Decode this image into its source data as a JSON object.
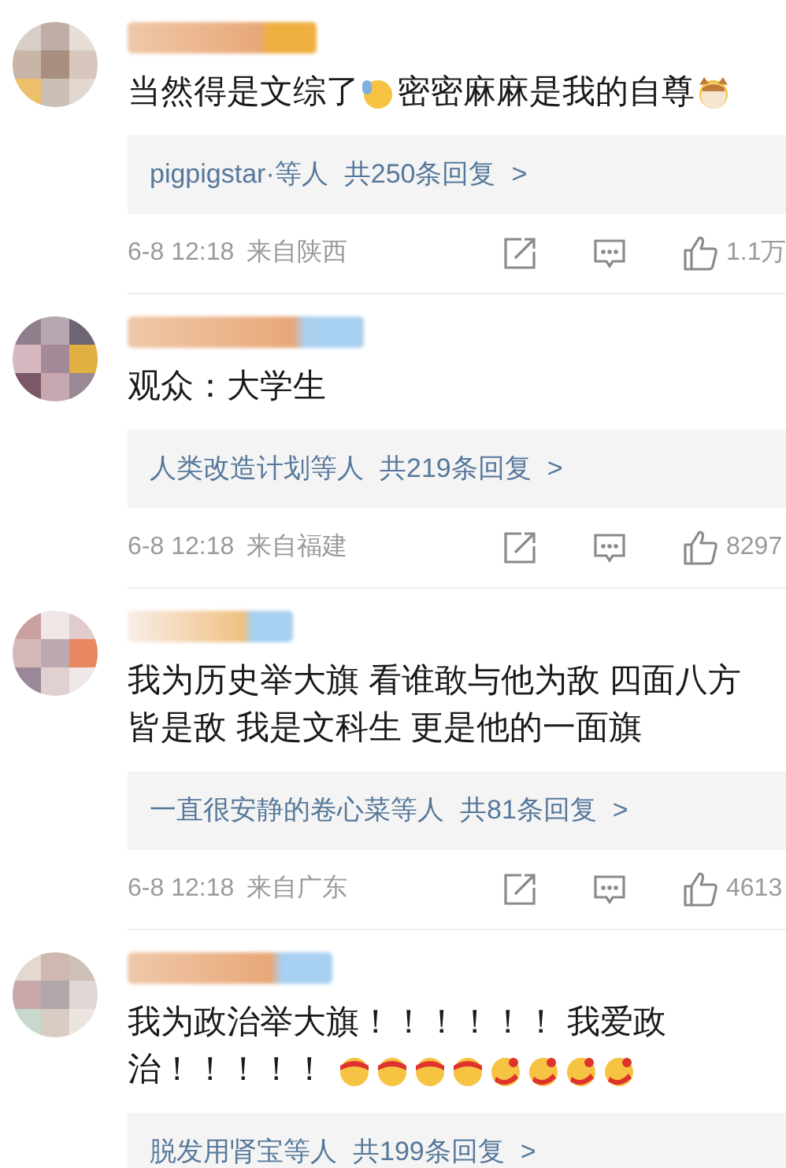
{
  "comments": [
    {
      "lines": [
        [
          {
            "kind": "text",
            "text": "当然得是文综了"
          },
          {
            "kind": "waving"
          },
          {
            "kind": "text",
            "text": "密密麻麻是我的自尊"
          },
          {
            "kind": "cat"
          }
        ]
      ],
      "reply": {
        "names": "pigpigstar·等人",
        "count": "共250条回复",
        "chevron": ">"
      },
      "time": "6-8 12:18",
      "location": "来自陕西",
      "likes": "1.1万"
    },
    {
      "lines": [
        [
          {
            "kind": "text",
            "text": "观众：大学生"
          }
        ]
      ],
      "reply": {
        "names": "人类改造计划等人",
        "count": "共219条回复",
        "chevron": ">"
      },
      "time": "6-8 12:18",
      "location": "来自福建",
      "likes": "8297"
    },
    {
      "lines": [
        [
          {
            "kind": "text",
            "text": "我为历史举大旗 看谁敢与他为敌 四面八方"
          }
        ],
        [
          {
            "kind": "text",
            "text": "皆是敌 我是文科生 更是他的一面旗"
          }
        ]
      ],
      "reply": {
        "names": "一直很安静的卷心菜等人",
        "count": "共81条回复",
        "chevron": ">"
      },
      "time": "6-8 12:18",
      "location": "来自广东",
      "likes": "4613"
    },
    {
      "lines": [
        [
          {
            "kind": "text",
            "text": "我为政治举大旗！！！！！！ 我爱政"
          }
        ],
        [
          {
            "kind": "text",
            "text": "治！！！！！ "
          },
          {
            "kind": "headband"
          },
          {
            "kind": "headband"
          },
          {
            "kind": "headband"
          },
          {
            "kind": "headband"
          },
          {
            "kind": "hug"
          },
          {
            "kind": "hug"
          },
          {
            "kind": "hug"
          },
          {
            "kind": "hug"
          }
        ]
      ],
      "reply": {
        "names": "脱发用肾宝等人",
        "count": "共199条回复",
        "chevron": ">"
      }
    }
  ]
}
